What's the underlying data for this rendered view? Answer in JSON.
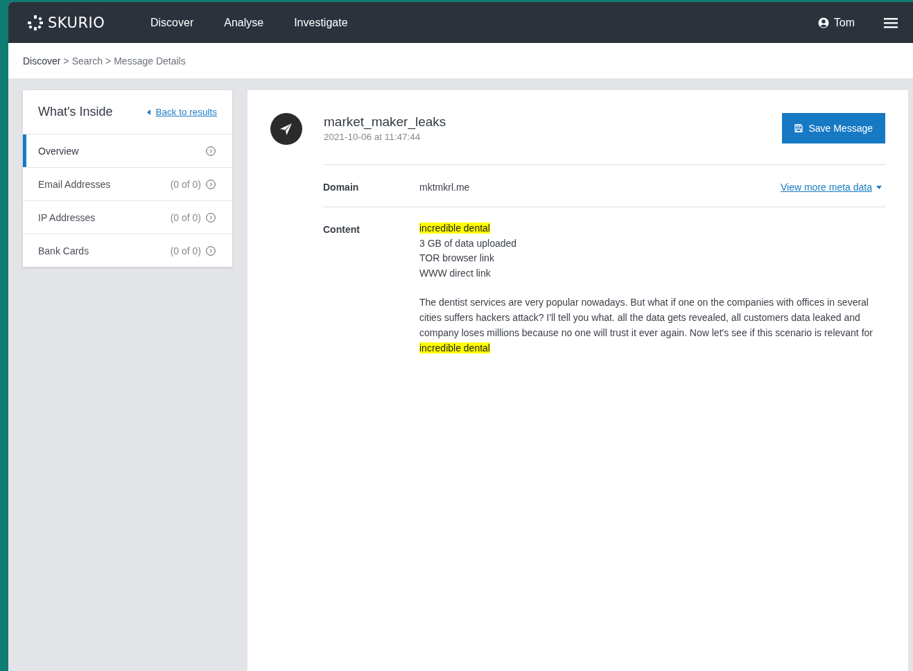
{
  "navbar": {
    "logo": "SKURIO",
    "links": [
      {
        "label": "Discover"
      },
      {
        "label": "Analyse"
      },
      {
        "label": "Investigate"
      }
    ],
    "user": "Tom"
  },
  "breadcrumb": {
    "separator": ">",
    "items": [
      "Discover",
      "Search",
      "Message Details"
    ]
  },
  "sidebar": {
    "title": "What's Inside",
    "back_link": "Back to results",
    "items": [
      {
        "label": "Overview",
        "selected": true
      },
      {
        "label": "Email Addresses",
        "count": "(0 of 0)",
        "selected": false
      },
      {
        "label": "IP Addresses",
        "count": "(0 of 0)",
        "selected": false
      },
      {
        "label": "Bank Cards",
        "count": "(0 of 0)",
        "selected": false
      }
    ]
  },
  "message": {
    "title": "market_maker_leaks",
    "timestamp": "2021-10-06 at 11:47:44",
    "save_button": "Save Message",
    "fields": [
      {
        "label": "Domain",
        "value": "mktmkrl.me",
        "link": "View more meta data"
      },
      {
        "label": "Content",
        "lines": [
          [
            {
              "text": "incredible dental",
              "highlighted": true
            }
          ],
          [
            {
              "text": "3 GB of data uploaded",
              "highlighted": false
            }
          ],
          [
            {
              "text": "TOR browser link",
              "highlighted": false
            }
          ],
          [
            {
              "text": "WWW direct link",
              "highlighted": false
            }
          ]
        ],
        "paragraph": [
          {
            "text": "The dentist services are very popular nowadays. But what if one on the companies with offices in several cities suffers hackers attack? I'll tell you what. all the data gets revealed, all customers data leaked and company loses millions because no one will trust it ever again. Now let's see if this scenario is relevant for ",
            "highlighted": false
          },
          {
            "text": "incredible dental",
            "highlighted": true
          }
        ]
      }
    ]
  }
}
